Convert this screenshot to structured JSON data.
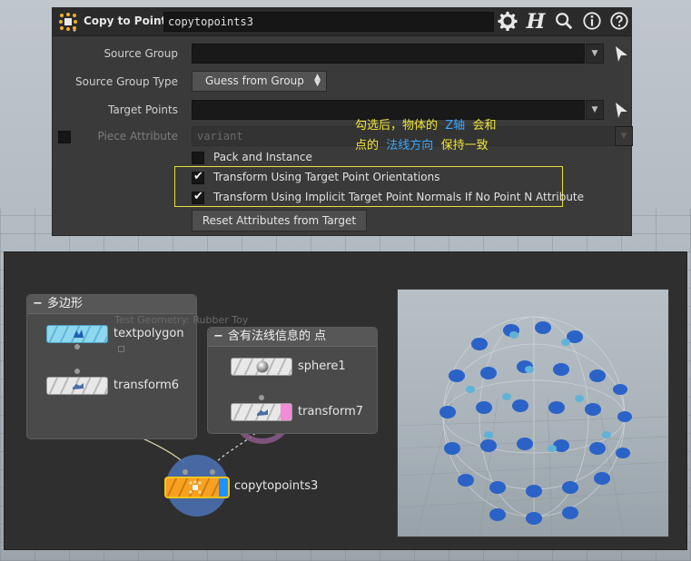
{
  "param_panel": {
    "node_type_label": "Copy to Points",
    "node_name": "copytopoints3",
    "header_icons": [
      "gear-icon",
      "houdini-help-icon",
      "search-icon",
      "info-icon",
      "help-icon"
    ],
    "source_group": {
      "label": "Source Group",
      "value": ""
    },
    "source_group_type": {
      "label": "Source Group Type",
      "value": "Guess from Group"
    },
    "target_points": {
      "label": "Target Points",
      "value": ""
    },
    "piece_attribute": {
      "label": "Piece Attribute",
      "value": "variant"
    },
    "pack_and_instance": {
      "label": "Pack and Instance",
      "checked": false
    },
    "transform_orient": {
      "label": "Transform Using Target Point Orientations",
      "checked": true
    },
    "transform_normals": {
      "label": "Transform Using Implicit Target Point Normals If No Point N Attribute",
      "checked": true
    },
    "reset_button": "Reset Attributes from Target",
    "annotation": {
      "line1_a": "勾选后，物体的",
      "line1_b": "Z轴",
      "line1_c": "会和",
      "line2_a": "点的",
      "line2_b": "法线方向",
      "line2_c": "保持一致"
    }
  },
  "network": {
    "box1_title": "多边形",
    "box2_title": "含有法线信息的 点",
    "ghost_text": "Test Geometry: Rubber Toy",
    "nodes": {
      "textpolygon": "textpolygon",
      "transform6": "transform6",
      "sphere1": "sphere1",
      "transform7": "transform7",
      "copytopoints3": "copytopoints3"
    }
  },
  "colors": {
    "accent_yellow": "#f0e63a",
    "accent_blue": "#38a8ff",
    "copy_node_orange": "#f8a020",
    "display_flag_blue": "#1e90ff",
    "template_flag_pink": "#f28bd8"
  }
}
